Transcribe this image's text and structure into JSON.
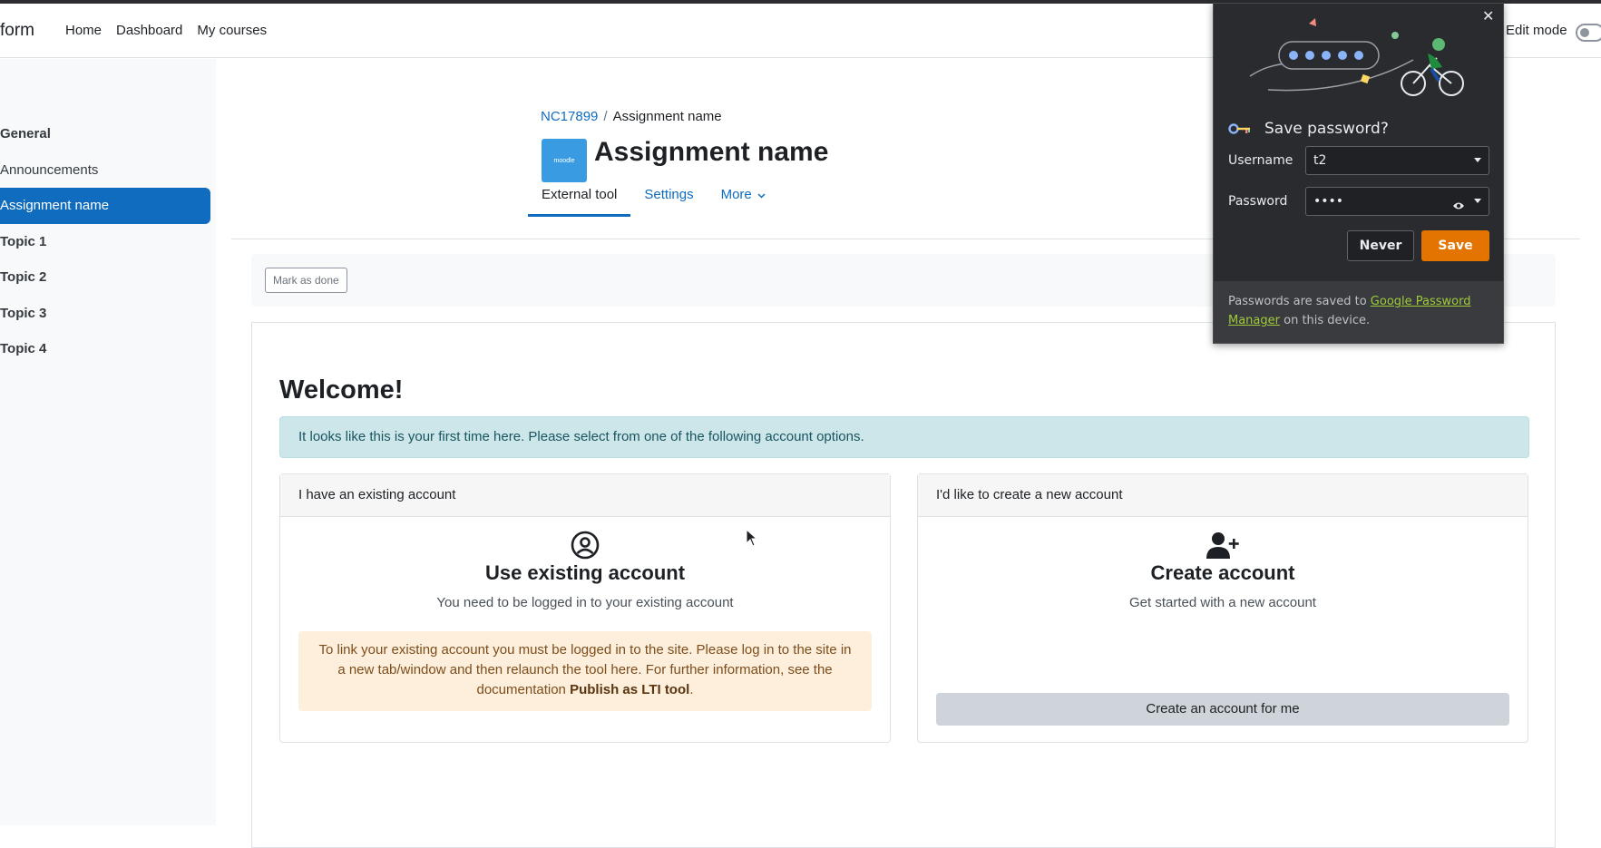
{
  "navbar": {
    "brand": "form",
    "links": [
      "Home",
      "Dashboard",
      "My courses"
    ],
    "edit_mode_label": "Edit mode"
  },
  "sidebar": {
    "items": [
      {
        "label": "General",
        "style": "bold"
      },
      {
        "label": "Announcements",
        "style": "normal"
      },
      {
        "label": "Assignment name",
        "style": "active"
      },
      {
        "label": "Topic 1",
        "style": "bold"
      },
      {
        "label": "Topic 2",
        "style": "bold"
      },
      {
        "label": "Topic 3",
        "style": "bold"
      },
      {
        "label": "Topic 4",
        "style": "bold"
      }
    ]
  },
  "page": {
    "breadcrumb": {
      "course": "NC17899",
      "separator": "/",
      "current": "Assignment name"
    },
    "logo_text": "moodle",
    "title": "Assignment name",
    "tabs": [
      "External tool",
      "Settings",
      "More"
    ],
    "mark_done_label": "Mark as done"
  },
  "welcome": {
    "heading": "Welcome!",
    "info": "It looks like this is your first time here. Please select from one of the following account options."
  },
  "existing_card": {
    "header": "I have an existing account",
    "title": "Use existing account",
    "subtitle": "You need to be logged in to your existing account",
    "warning_text": "To link your existing account you must be logged in to the site. Please log in to the site in a new tab/window and then relaunch the tool here. For further information, see the documentation",
    "warning_link": "Publish as LTI tool",
    "warning_end": "."
  },
  "new_card": {
    "header": "I'd like to create a new account",
    "title": "Create account",
    "subtitle": "Get started with a new account",
    "button": "Create an account for me"
  },
  "password_popup": {
    "title": "Save password?",
    "username_label": "Username",
    "username_value": "t2",
    "password_label": "Password",
    "password_value": "••••",
    "never_label": "Never",
    "save_label": "Save",
    "footer_prefix": "Passwords are saved to",
    "footer_link": "Google Password Manager",
    "footer_suffix": "on this device.",
    "save_color": "#e37400"
  }
}
